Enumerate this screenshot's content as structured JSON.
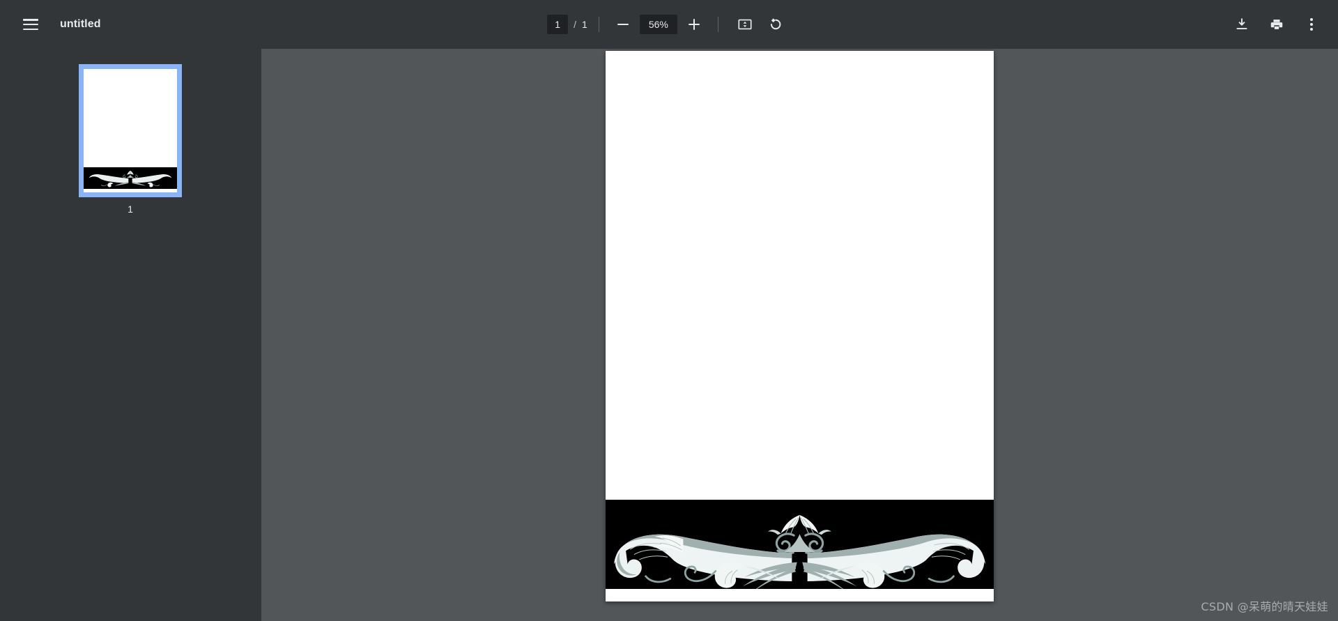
{
  "toolbar": {
    "menu_icon": "hamburger-menu-icon",
    "title": "untitled",
    "page_current": "1",
    "page_separator": "/",
    "page_total": "1",
    "zoom_out_icon": "minus-icon",
    "zoom_level": "56%",
    "zoom_in_icon": "plus-icon",
    "fit_page_icon": "fit-to-page-icon",
    "rotate_icon": "rotate-counterclockwise-icon",
    "download_icon": "download-icon",
    "print_icon": "print-icon",
    "more_icon": "more-options-kebab-icon"
  },
  "sidebar": {
    "thumbnails": [
      {
        "label": "1",
        "selected": true
      }
    ]
  },
  "document": {
    "page_number": 1,
    "background": "#ffffff",
    "ornament": {
      "name": "floral-flourish-ornament",
      "band_color": "#000000",
      "scroll_color_light": "#ffffff",
      "scroll_color_mid": "#d6dedd",
      "scroll_color_dark": "#8fa3a3"
    }
  },
  "watermark": {
    "text": "CSDN @呆萌的晴天娃娃"
  },
  "colors": {
    "toolbar_bg": "#323639",
    "sidebar_bg": "#323639",
    "viewer_bg": "#525659",
    "input_bg": "#202124",
    "accent_selection": "#8ab4f8",
    "text_primary": "#e8eaed"
  }
}
